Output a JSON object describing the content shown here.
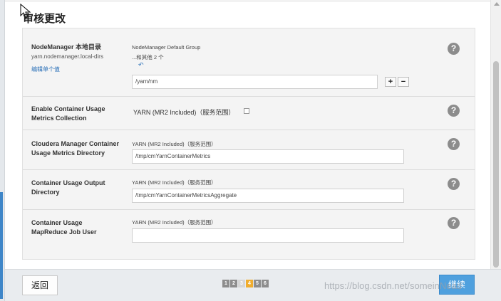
{
  "dialog": {
    "title": "审核更改"
  },
  "rows": [
    {
      "label": "NodeManager 本地目录",
      "property": "yarn.nodemanager.local-dirs",
      "edit_link": "编辑单个值",
      "group": "NodeManager Default Group",
      "group_more": "...和其他 2 个",
      "undo": "↶",
      "value": "/yarn/nm",
      "add": "+",
      "remove": "−"
    },
    {
      "label_line1": "Enable Container Usage",
      "label_line2": "Metrics Collection",
      "scope": "YARN (MR2 Included)（服务范围）",
      "checked": false
    },
    {
      "label_line1": "Cloudera Manager Container",
      "label_line2": "Usage Metrics Directory",
      "scope": "YARN (MR2 Included)（服务范围）",
      "value": "/tmp/cmYarnContainerMetrics"
    },
    {
      "label_line1": "Container Usage Output",
      "label_line2": "Directory",
      "scope": "YARN (MR2 Included)（服务范围）",
      "value": "/tmp/cmYarnContainerMetricsAggregate"
    },
    {
      "label_line1": "Container Usage",
      "label_line2": "MapReduce Job User",
      "scope": "YARN (MR2 Included)（服务范围）",
      "value": ""
    }
  ],
  "help_icon": "?",
  "footer": {
    "back_label": "返回",
    "continue_label": "继续",
    "steps": [
      "1",
      "2",
      "3",
      "4",
      "5",
      "6"
    ],
    "current_step": "4",
    "disabled_step": "3"
  },
  "watermark": "https://blog.csdn.net/someinNead"
}
